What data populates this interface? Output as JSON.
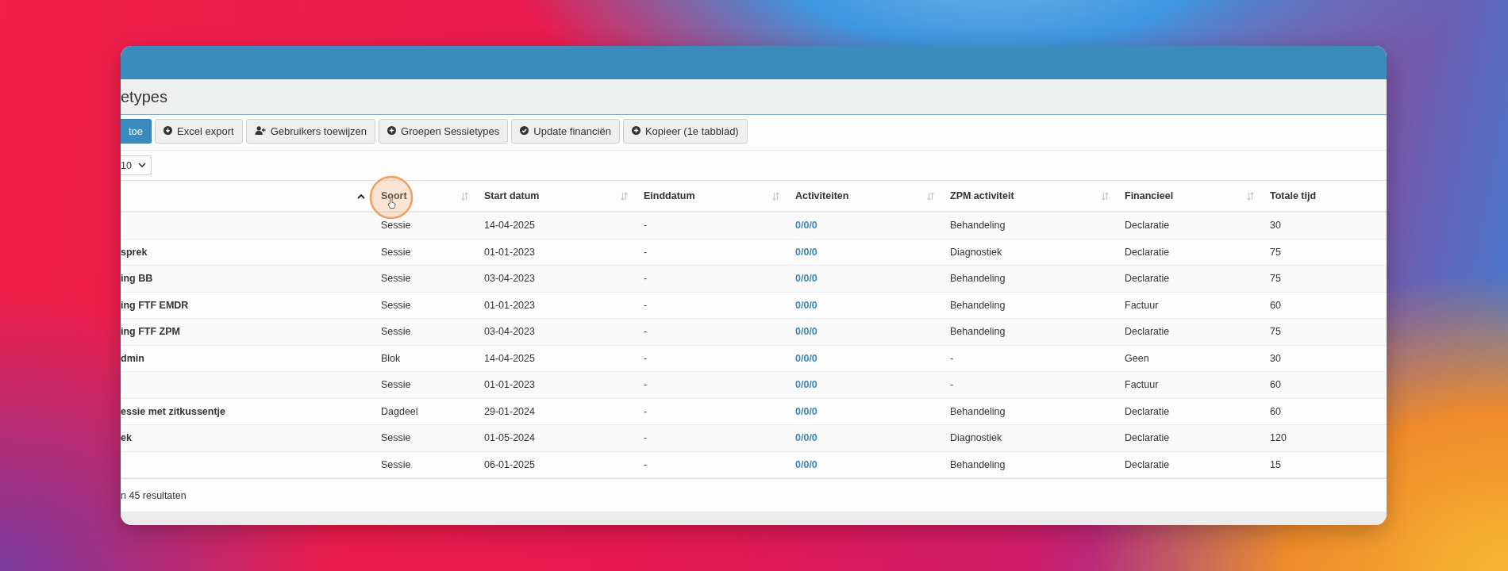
{
  "page_header": {
    "title": "etypes"
  },
  "toolbar": {
    "buttons": [
      {
        "label": "toe",
        "kind": "primary"
      },
      {
        "label": "Excel export",
        "kind": "default"
      },
      {
        "label": "Gebruikers toewijzen",
        "kind": "default"
      },
      {
        "label": "Groepen Sessietypes",
        "kind": "default"
      },
      {
        "label": "Update financiën",
        "kind": "default"
      },
      {
        "label": "Kopieer (1e tabblad)",
        "kind": "default"
      }
    ]
  },
  "page_size": {
    "value": "10"
  },
  "table": {
    "columns": [
      {
        "sorted": true
      },
      {
        "label": "Soort",
        "sorted": false
      },
      {
        "label": "Start datum",
        "sorted": false
      },
      {
        "label": "Einddatum",
        "sorted": false
      },
      {
        "label": "Activiteiten",
        "sorted": false
      },
      {
        "label": "ZPM activiteit",
        "sorted": false
      },
      {
        "label": "Financieel",
        "sorted": false
      },
      {
        "label": "Totale tijd"
      }
    ],
    "rows": [
      {
        "cells": [
          "",
          "Sessie",
          "14-04-2025",
          "-",
          "0/0/0",
          "Behandeling",
          "Declaratie",
          "30"
        ]
      },
      {
        "cells": [
          "sprek",
          "Sessie",
          "01-01-2023",
          "-",
          "0/0/0",
          "Diagnostiek",
          "Declaratie",
          "75"
        ]
      },
      {
        "cells": [
          "ing BB",
          "Sessie",
          "03-04-2023",
          "-",
          "0/0/0",
          "Behandeling",
          "Declaratie",
          "75"
        ]
      },
      {
        "cells": [
          "ing FTF EMDR",
          "Sessie",
          "01-01-2023",
          "-",
          "0/0/0",
          "Behandeling",
          "Factuur",
          "60"
        ]
      },
      {
        "cells": [
          "ing FTF ZPM",
          "Sessie",
          "03-04-2023",
          "-",
          "0/0/0",
          "Behandeling",
          "Declaratie",
          "75"
        ]
      },
      {
        "cells": [
          "dmin",
          "Blok",
          "14-04-2025",
          "-",
          "0/0/0",
          "-",
          "Geen",
          "30"
        ]
      },
      {
        "cells": [
          "",
          "Sessie",
          "01-01-2023",
          "-",
          "0/0/0",
          "-",
          "Factuur",
          "60"
        ]
      },
      {
        "cells": [
          "essie met zitkussentje",
          "Dagdeel",
          "29-01-2024",
          "-",
          "0/0/0",
          "Behandeling",
          "Declaratie",
          "60"
        ]
      },
      {
        "cells": [
          "ek",
          "Sessie",
          "01-05-2024",
          "-",
          "0/0/0",
          "Diagnostiek",
          "Declaratie",
          "120"
        ]
      },
      {
        "cells": [
          "",
          "Sessie",
          "06-01-2025",
          "-",
          "0/0/0",
          "Behandeling",
          "Declaratie",
          "15"
        ]
      }
    ]
  },
  "footer": {
    "summary": "n 45 resultaten"
  }
}
